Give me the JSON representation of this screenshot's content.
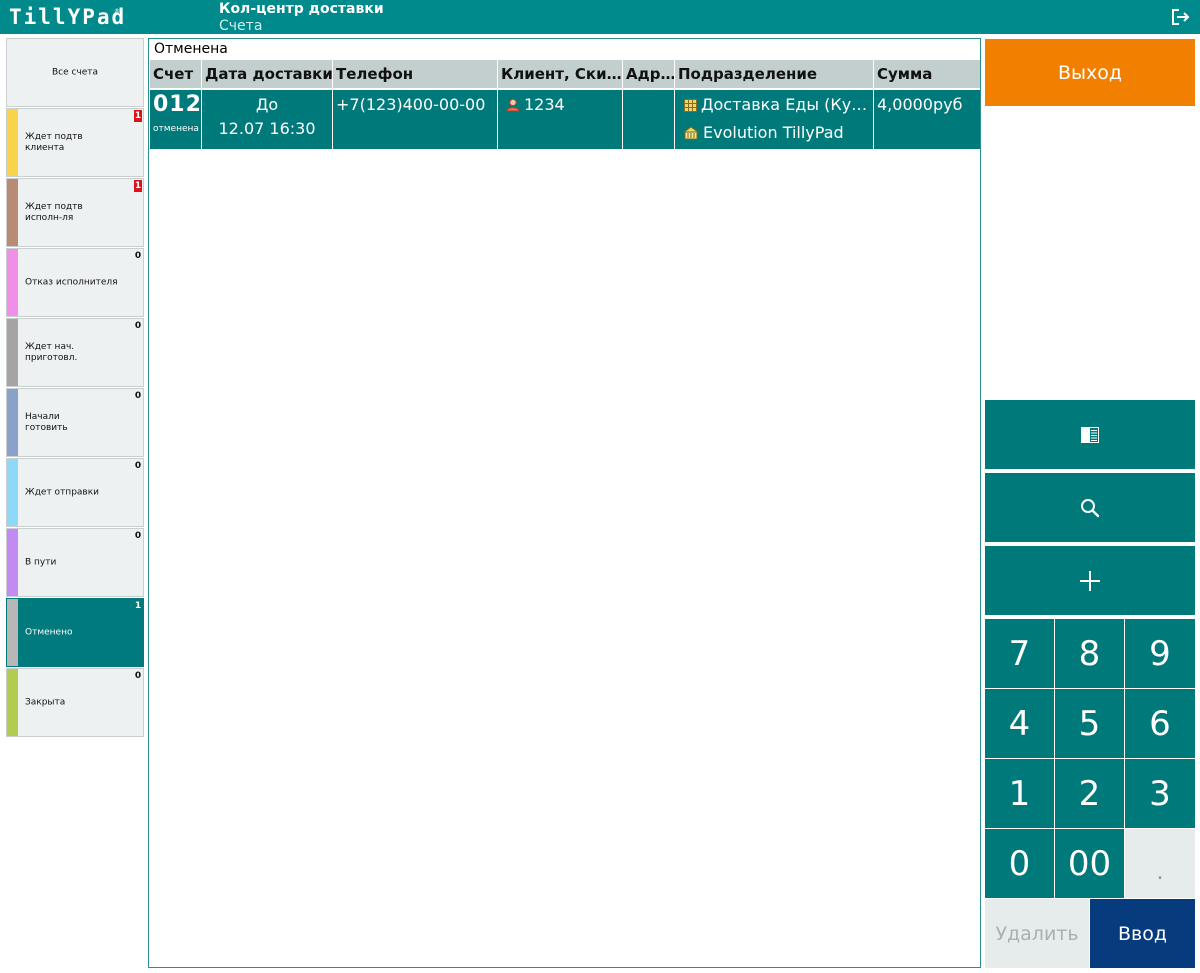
{
  "header": {
    "logo": "TillYPad",
    "logo_mark": "®",
    "title": "Кол-центр доставки",
    "subtitle": "Счета",
    "exit_icon": "logout-icon"
  },
  "sidebar": {
    "items": [
      {
        "label": "Все счета",
        "count": "",
        "color": ""
      },
      {
        "label": "Ждет подтв\nклиента",
        "count": "1",
        "color": "#f8d44a",
        "alert": true
      },
      {
        "label": "Ждет подтв\nисполн-ля",
        "count": "1",
        "color": "#b98b74",
        "alert": true
      },
      {
        "label": "Отказ исполнителя",
        "count": "0",
        "color": "#f08fe8"
      },
      {
        "label": "Ждет нач.\nприготовл.",
        "count": "0",
        "color": "#a6a3a3"
      },
      {
        "label": "Начали\nготовить",
        "count": "0",
        "color": "#8aa1c9"
      },
      {
        "label": "Ждет отправки",
        "count": "0",
        "color": "#8fd9f8"
      },
      {
        "label": "В пути",
        "count": "0",
        "color": "#c38af2"
      },
      {
        "label": "Отменено",
        "count": "1",
        "color": "#b7b7b7",
        "active": true
      },
      {
        "label": "Закрыта",
        "count": "0",
        "color": "#b1cc4f"
      }
    ]
  },
  "main": {
    "filter_title": "Отменена",
    "columns": [
      "Счет",
      "Дата доставки",
      "Телефон",
      "Клиент, Ски…",
      "Адр…",
      "Подразделение",
      "Сумма"
    ],
    "rows": [
      {
        "number": "012",
        "status": "отменена",
        "date_prefix": "До",
        "date": "12.07 16:30",
        "phone": "+7(123)400-00-00",
        "client": "1234",
        "client_icon": "user-icon",
        "address": "",
        "division": "Доставка Еды (Ку…",
        "division_icon": "grid-icon",
        "company": "Evolution TillyPad",
        "company_icon": "building-icon",
        "sum": "4,0000руб"
      }
    ]
  },
  "right_panel": {
    "exit_label": "Выход",
    "buttons": [
      {
        "name": "layout-toggle-button",
        "icon": "panel-icon"
      },
      {
        "name": "search-button",
        "icon": "search-icon"
      },
      {
        "name": "add-button",
        "icon": "plus-icon"
      }
    ],
    "keypad": [
      "7",
      "8",
      "9",
      "4",
      "5",
      "6",
      "1",
      "2",
      "3",
      "0",
      "00",
      "."
    ],
    "delete_label": "Удалить",
    "enter_label": "Ввод"
  },
  "colors": {
    "header": "#008a8c",
    "teal": "#00797b",
    "exit": "#f18000",
    "enter": "#063c7e",
    "alert": "#d9141c"
  }
}
